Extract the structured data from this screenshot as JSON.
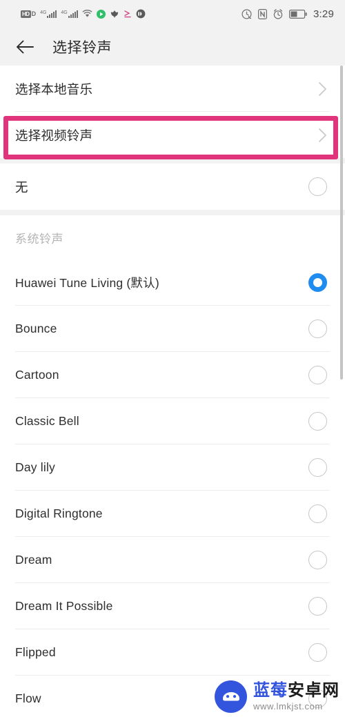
{
  "statusbar": {
    "left_icons": [
      {
        "name": "hd-volte-icon",
        "label": "HD"
      },
      {
        "name": "signal-4g-sim1-icon",
        "label": "4G"
      },
      {
        "name": "signal-4g-sim2-icon",
        "label": "4G"
      },
      {
        "name": "wifi-icon",
        "label": "wifi"
      },
      {
        "name": "app-green-circle-icon",
        "label": ""
      },
      {
        "name": "huawei-petal-icon",
        "label": ""
      },
      {
        "name": "arrow-app-icon",
        "label": ""
      },
      {
        "name": "headphone-icon",
        "label": ""
      }
    ],
    "right_icons": [
      {
        "name": "do-not-disturb-icon",
        "label": ""
      },
      {
        "name": "nfc-icon",
        "label": "N"
      },
      {
        "name": "alarm-icon",
        "label": ""
      },
      {
        "name": "battery-icon",
        "label": ""
      }
    ],
    "time": "3:29"
  },
  "appbar": {
    "back_icon": "back-arrow-icon",
    "title": "选择铃声"
  },
  "colors": {
    "accent_selected": "#1f8df0",
    "highlight_box": "#e0347c",
    "statusbar_bg": "#f2f2f2",
    "divider": "#ececec",
    "section_header_text": "#b4b4b4"
  },
  "top_actions": [
    {
      "label": "选择本地音乐",
      "chevron": true,
      "highlighted": false
    },
    {
      "label": "选择视频铃声",
      "chevron": true,
      "highlighted": true
    }
  ],
  "none_row": {
    "label": "无",
    "selected": false
  },
  "section": {
    "header": "系统铃声",
    "items": [
      {
        "label": "Huawei Tune Living (默认)",
        "selected": true
      },
      {
        "label": "Bounce",
        "selected": false
      },
      {
        "label": "Cartoon",
        "selected": false
      },
      {
        "label": "Classic Bell",
        "selected": false
      },
      {
        "label": "Day lily",
        "selected": false
      },
      {
        "label": "Digital Ringtone",
        "selected": false
      },
      {
        "label": "Dream",
        "selected": false
      },
      {
        "label": "Dream It Possible",
        "selected": false
      },
      {
        "label": "Flipped",
        "selected": false
      },
      {
        "label": "Flow",
        "selected": false
      }
    ]
  },
  "watermark": {
    "text_part1": "蓝莓",
    "text_part2": "安卓网",
    "url": "www.lmkjst.com"
  }
}
